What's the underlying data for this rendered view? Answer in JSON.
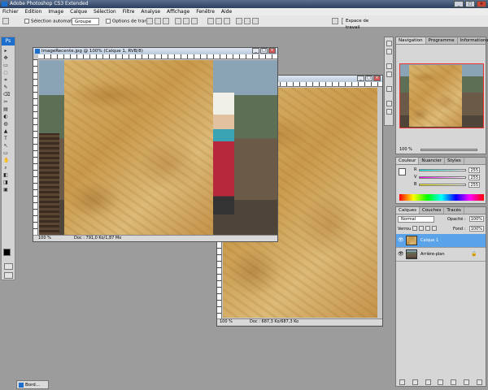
{
  "app": {
    "title": "Adobe Photoshop CS3 Extended"
  },
  "window_buttons": {
    "minimize": "_",
    "maximize": "□",
    "close": "×"
  },
  "menu": [
    "Fichier",
    "Edition",
    "Image",
    "Calque",
    "Sélection",
    "Filtre",
    "Analyse",
    "Affichage",
    "Fenêtre",
    "Aide"
  ],
  "options": {
    "auto_select_label": "Sélection automatique :",
    "auto_select_value": "Groupe",
    "transform_label": "Options de transf.",
    "workspace_label": "Espace de travail"
  },
  "toolbox": {
    "logo": "Ps",
    "tools": [
      "▸",
      "✥",
      "▭",
      "◌",
      "⌗",
      "✎",
      "⌫",
      "✂",
      "▤",
      "◐",
      "◍",
      "▲",
      "T",
      "↖",
      "▭",
      "✋",
      "⌕",
      "◧",
      "◨",
      "▣"
    ]
  },
  "doc_front": {
    "title": "ImageRecente.jpg @ 100% (Calque 1, RVB/8)",
    "zoom": "100 %",
    "info": "Doc : 791,0 Ko/1,87 Mo"
  },
  "doc_back": {
    "zoom": "100 %",
    "info": "Doc : 687,3 Ko/687,3 Ko"
  },
  "navigator": {
    "tabs": [
      "Navigation",
      "Programme",
      "Informations"
    ],
    "zoom": "100 %"
  },
  "color": {
    "tabs": [
      "Couleur",
      "Nuancier",
      "Styles"
    ],
    "r_label": "R",
    "v_label": "V",
    "b_label": "B",
    "r": "255",
    "v": "255",
    "b": "255"
  },
  "layers": {
    "tabs": [
      "Calques",
      "Couches",
      "Tracés"
    ],
    "blend_mode": "Normal",
    "opacity_label": "Opacité :",
    "opacity": "100%",
    "lock_label": "Verrou :",
    "fill_label": "Fond :",
    "fill": "100%",
    "items": [
      {
        "name": "Calque 1",
        "selected": true
      },
      {
        "name": "Arrière-plan",
        "selected": false
      }
    ]
  },
  "taskbar": {
    "label": "Bord..."
  },
  "colors": {
    "accent": "#3a8ee6",
    "selection": "#5aa3e8",
    "title_bar": "#2b3f5e"
  }
}
